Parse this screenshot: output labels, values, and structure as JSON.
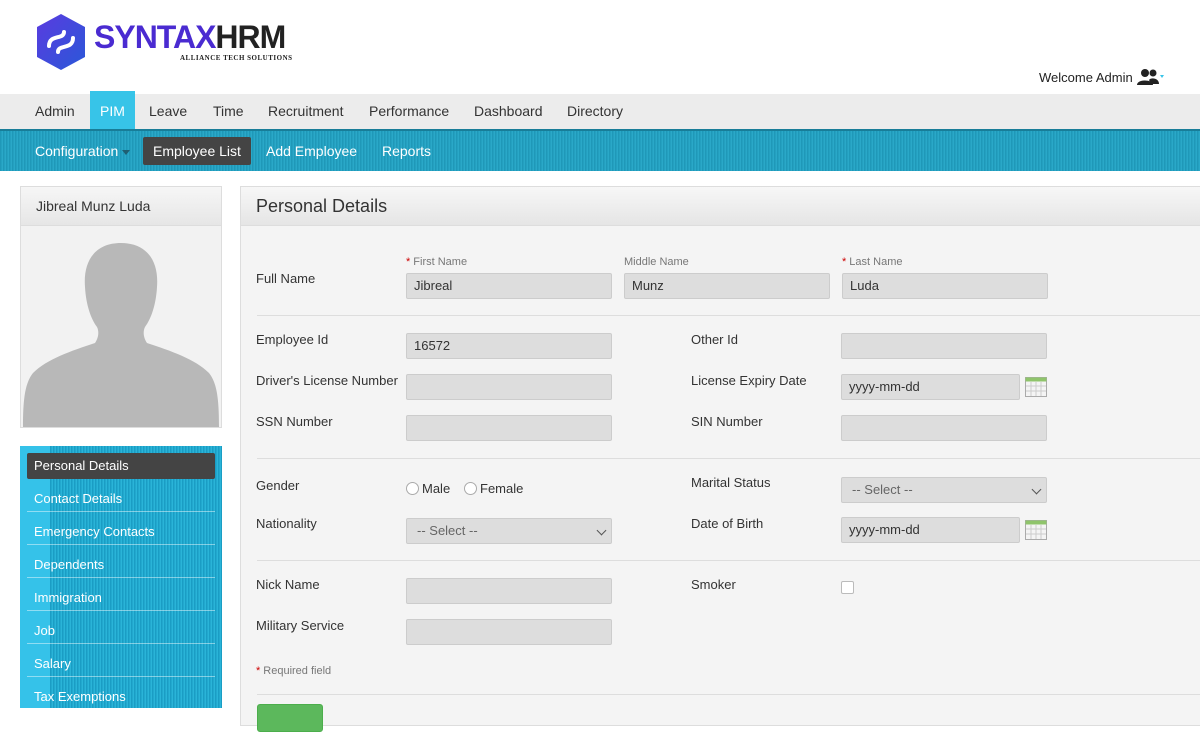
{
  "brand": {
    "name_part1": "SYNTAX",
    "name_part2": "HRM",
    "tagline": "ALLIANCE TECH SOLUTIONS"
  },
  "header": {
    "welcome": "Welcome Admin",
    "user_icon": "users-icon"
  },
  "main_nav": [
    "Admin",
    "PIM",
    "Leave",
    "Time",
    "Recruitment",
    "Performance",
    "Dashboard",
    "Directory"
  ],
  "main_nav_active": "PIM",
  "sub_nav": [
    "Configuration",
    "Employee List",
    "Add Employee",
    "Reports"
  ],
  "sub_nav_active": "Employee List",
  "profile": {
    "name": "Jibreal Munz Luda"
  },
  "side_menu": [
    "Personal Details",
    "Contact Details",
    "Emergency Contacts",
    "Dependents",
    "Immigration",
    "Job",
    "Salary",
    "Tax Exemptions"
  ],
  "side_menu_active": "Personal Details",
  "personal_details": {
    "title": "Personal Details",
    "full_name_label": "Full Name",
    "first_name_label": "First Name",
    "first_name": "Jibreal",
    "middle_name_label": "Middle Name",
    "middle_name": "Munz",
    "last_name_label": "Last Name",
    "last_name": "Luda",
    "employee_id_label": "Employee Id",
    "employee_id": "16572",
    "other_id_label": "Other Id",
    "other_id": "",
    "drivers_license_label": "Driver's License Number",
    "drivers_license": "",
    "license_expiry_label": "License Expiry Date",
    "license_expiry": "yyyy-mm-dd",
    "ssn_label": "SSN Number",
    "ssn": "",
    "sin_label": "SIN Number",
    "sin": "",
    "gender_label": "Gender",
    "gender_options": [
      "Male",
      "Female"
    ],
    "marital_status_label": "Marital Status",
    "marital_status": "-- Select --",
    "nationality_label": "Nationality",
    "nationality": "-- Select --",
    "dob_label": "Date of Birth",
    "dob": "yyyy-mm-dd",
    "nick_name_label": "Nick Name",
    "nick_name": "",
    "smoker_label": "Smoker",
    "military_label": "Military Service",
    "military": "",
    "required_note": "Required field",
    "required_marker": "*"
  },
  "colors": {
    "accent": "#37c4e8",
    "subnav": "#2aa8c8",
    "active_dark": "#444444",
    "brand_purple": "#4a2bd1",
    "save_green": "#5cb85c"
  }
}
